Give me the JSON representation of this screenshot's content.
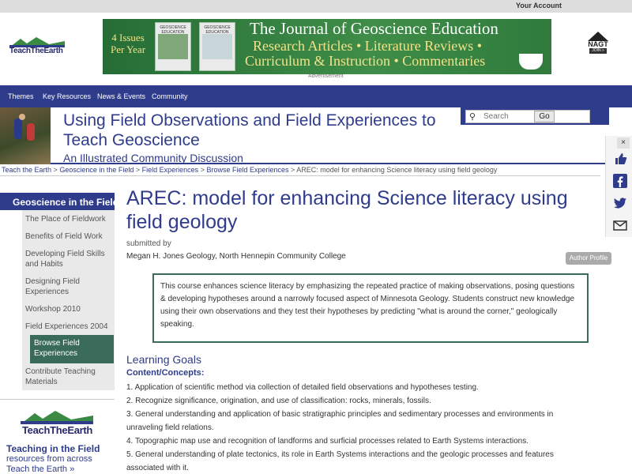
{
  "topbar": {
    "account": "Your Account"
  },
  "header": {
    "logo": "TeachTheEarth",
    "banner": {
      "issues": "4 Issues Per Year",
      "cover_title": "GEOSCIENCE EDUCATION",
      "journal": "The Journal of Geoscience Education",
      "line1": "Research Articles • Literature Reviews •",
      "line2": "Curriculum & Instruction • Commentaries"
    },
    "advertisement": "Advertisement",
    "nagt": {
      "name": "NAGT",
      "join": "JOIN »"
    }
  },
  "nav": {
    "items": [
      "Themes",
      "Key Resources",
      "News & Events",
      "Community"
    ]
  },
  "title": {
    "main": "Using Field Observations and Field Experiences to Teach Geoscience",
    "sub": "An Illustrated Community Discussion"
  },
  "search": {
    "placeholder": "Search",
    "button": "Go"
  },
  "breadcrumb": {
    "links": [
      "Teach the Earth",
      "Geoscience in the Field",
      "Field Experiences",
      "Browse Field Experiences"
    ],
    "current": "AREC: model for enhancing Science literacy using field geology",
    "sep": " > "
  },
  "social": {
    "close": "×",
    "icons": [
      "like-icon",
      "facebook-icon",
      "twitter-icon",
      "email-icon"
    ]
  },
  "sidebar": {
    "header": "Geoscience in the Field",
    "items": [
      "The Place of Fieldwork",
      "Benefits of Field Work",
      "Developing Field Skills and Habits",
      "Designing Field Experiences",
      "Workshop 2010",
      "Field Experiences 2004",
      "Contribute Teaching Materials"
    ],
    "active": "Browse Field Experiences"
  },
  "tte_box": {
    "logo": "TeachTheEarth",
    "heading": "Teaching in the Field",
    "sub": "resources from across Teach the Earth »"
  },
  "main": {
    "heading": "AREC: model for enhancing Science literacy using field geology",
    "submitted_by": "submitted by",
    "author": "Megan H. Jones Geology, North Hennepin Community College",
    "author_profile": "Author Profile",
    "description": "This course enhances science literacy by emphasizing the repeated practice of making observations, posing questions & developing hypotheses around a narrowly focused aspect of Minnesota Geology. Students construct new knowledge using their own observations and they test their hypotheses by predicting \"what is around the corner,\" geologically speaking.",
    "learning_goals": "Learning Goals",
    "content_concepts": "Content/Concepts:",
    "goals": [
      "1. Application of scientific method via collection of detailed field observations and hypotheses testing.",
      "2. Recognize significance, origination, and use of classification: rocks, minerals, fossils.",
      "3. General understanding and application of basic stratigraphic principles and sedimentary processes and environments in unraveling field relations.",
      "4. Topographic map use and recognition of landforms and surficial processes related to Earth Systems interactions.",
      "5. General understanding of plate tectonics, its role in Earth Systems interactions and the geologic processes and features associated with it."
    ]
  },
  "colors": {
    "brand_blue": "#2f3c8c",
    "accent_green": "#3a6b5a",
    "banner_green": "#2e6e3a"
  }
}
